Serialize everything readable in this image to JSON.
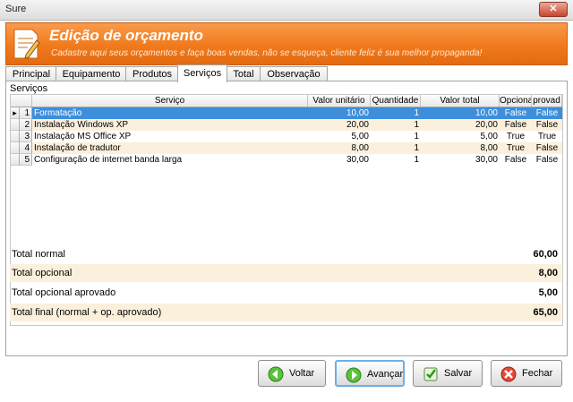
{
  "window": {
    "title": "Sure",
    "close_label": "✕"
  },
  "header": {
    "title": "Edição de orçamento",
    "subtitle": "Cadastre aqui seus orçamentos e faça boas vendas, não se esqueça, cliente feliz é sua melhor propaganda!"
  },
  "tabs": [
    "Principal",
    "Equipamento",
    "Produtos",
    "Serviços",
    "Total",
    "Observação"
  ],
  "active_tab": "Serviços",
  "section_label": "Serviços",
  "grid": {
    "columns": [
      "Serviço",
      "Valor unitário",
      "Quantidade",
      "Valor total",
      "Opciona",
      "provad"
    ],
    "rows": [
      {
        "n": "1",
        "servico": "Formatação",
        "valor_unitario": "10,00",
        "quantidade": "1",
        "valor_total": "10,00",
        "opcional": "False",
        "aprovado": "False"
      },
      {
        "n": "2",
        "servico": "Instalação Windows XP",
        "valor_unitario": "20,00",
        "quantidade": "1",
        "valor_total": "20,00",
        "opcional": "False",
        "aprovado": "False"
      },
      {
        "n": "3",
        "servico": "Instalação MS Office XP",
        "valor_unitario": "5,00",
        "quantidade": "1",
        "valor_total": "5,00",
        "opcional": "True",
        "aprovado": "True"
      },
      {
        "n": "4",
        "servico": "Instalação de tradutor",
        "valor_unitario": "8,00",
        "quantidade": "1",
        "valor_total": "8,00",
        "opcional": "True",
        "aprovado": "False"
      },
      {
        "n": "5",
        "servico": "Configuração de internet banda larga",
        "valor_unitario": "30,00",
        "quantidade": "1",
        "valor_total": "30,00",
        "opcional": "False",
        "aprovado": "False"
      }
    ],
    "row_pointer": "▸"
  },
  "totals": [
    {
      "label": "Total normal",
      "value": "60,00"
    },
    {
      "label": "Total opcional",
      "value": "8,00"
    },
    {
      "label": "Total opcional aprovado",
      "value": "5,00"
    },
    {
      "label": "Total final (normal + op. aprovado)",
      "value": "65,00"
    }
  ],
  "buttons": {
    "voltar": "Voltar",
    "avancar": "Avançar",
    "salvar": "Salvar",
    "fechar": "Fechar"
  },
  "colors": {
    "accent": "#f07a1c",
    "selection": "#3d8edb",
    "alt_row": "#fbf0dc"
  }
}
